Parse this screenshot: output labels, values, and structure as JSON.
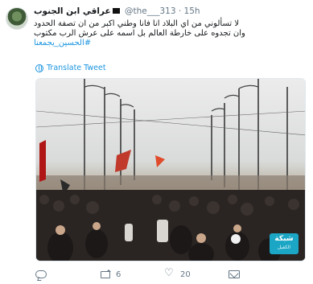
{
  "tweet": {
    "display_name": "عراقي ابن الجنوب",
    "handle": "@the___313",
    "separator": "·",
    "time": "15h",
    "text_lines": [
      "لا تسألوني من اي البلاد انا فانا وطني اكبر من ان تصفة الحدود",
      "وان تجدوه على خارطة العالم بل اسمه على عرش الرب مكتوب"
    ],
    "hashtag": "#الحسين_يجمعنا",
    "translate_label": "Translate Tweet",
    "channel_badge": {
      "title": "شبكة",
      "subtitle": "الكفيل"
    }
  },
  "actions": {
    "reply": {
      "icon": "reply-icon",
      "count": ""
    },
    "retweet": {
      "icon": "retweet-icon",
      "count": "6"
    },
    "like": {
      "icon": "heart-icon",
      "count": "20"
    },
    "dm": {
      "icon": "direct-message-icon",
      "count": ""
    }
  },
  "colors": {
    "link": "#1b95e0",
    "muted": "#657786",
    "text": "#14171a",
    "badge": "#1aa6c4"
  }
}
